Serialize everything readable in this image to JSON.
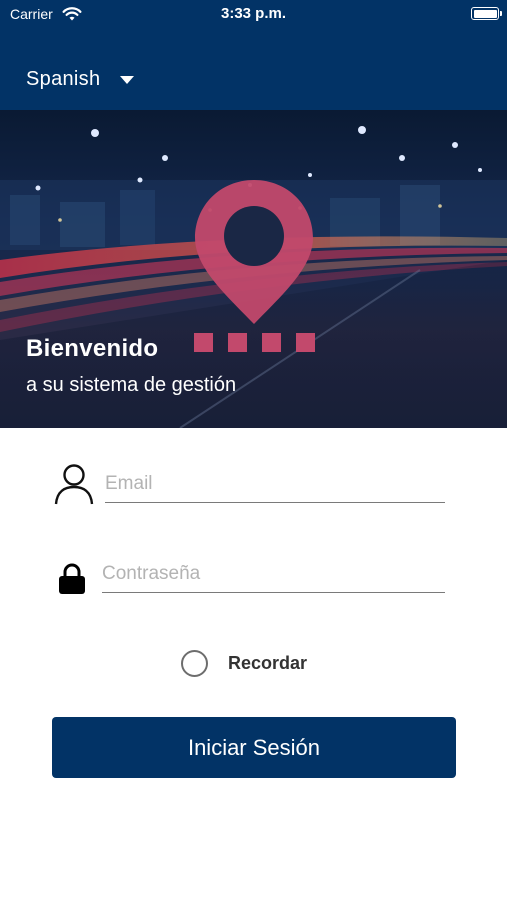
{
  "status_bar": {
    "carrier": "Carrier",
    "time": "3:33 p.m."
  },
  "header": {
    "language": "Spanish",
    "background_color": "#023366"
  },
  "hero": {
    "title": "Bienvenido",
    "subtitle": "a su sistema de gestión",
    "accent_color": "#c2496c"
  },
  "form": {
    "email_placeholder": "Email",
    "email_value": "",
    "password_placeholder": "Contraseña",
    "password_value": "",
    "remember_label": "Recordar",
    "remember_checked": false,
    "submit_label": "Iniciar Sesión"
  },
  "icons": [
    "wifi-icon",
    "battery-icon",
    "dropdown-caret-icon",
    "location-pin-icon",
    "user-icon",
    "lock-icon",
    "radio-unchecked-icon"
  ]
}
